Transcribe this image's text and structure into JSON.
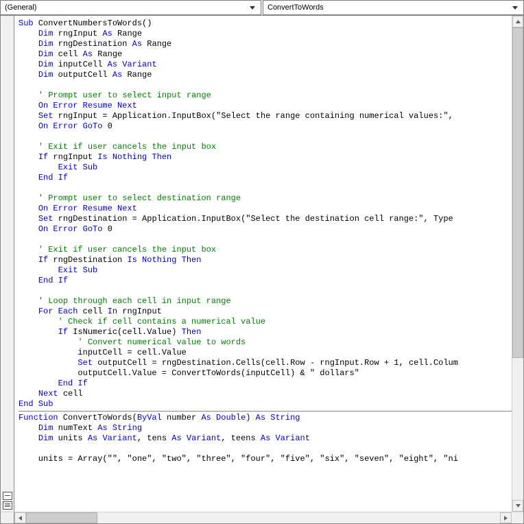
{
  "dropdowns": {
    "left": "(General)",
    "right": "ConvertToWords"
  },
  "code": [
    [
      [
        "kw",
        "Sub"
      ],
      [
        "tx",
        " ConvertNumbersToWords()"
      ]
    ],
    [
      [
        "tx",
        "    "
      ],
      [
        "kw",
        "Dim"
      ],
      [
        "tx",
        " rngInput "
      ],
      [
        "kw",
        "As"
      ],
      [
        "tx",
        " Range"
      ]
    ],
    [
      [
        "tx",
        "    "
      ],
      [
        "kw",
        "Dim"
      ],
      [
        "tx",
        " rngDestination "
      ],
      [
        "kw",
        "As"
      ],
      [
        "tx",
        " Range"
      ]
    ],
    [
      [
        "tx",
        "    "
      ],
      [
        "kw",
        "Dim"
      ],
      [
        "tx",
        " cell "
      ],
      [
        "kw",
        "As"
      ],
      [
        "tx",
        " Range"
      ]
    ],
    [
      [
        "tx",
        "    "
      ],
      [
        "kw",
        "Dim"
      ],
      [
        "tx",
        " inputCell "
      ],
      [
        "kw",
        "As Variant"
      ]
    ],
    [
      [
        "tx",
        "    "
      ],
      [
        "kw",
        "Dim"
      ],
      [
        "tx",
        " outputCell "
      ],
      [
        "kw",
        "As"
      ],
      [
        "tx",
        " Range"
      ]
    ],
    [
      [
        "tx",
        ""
      ]
    ],
    [
      [
        "tx",
        "    "
      ],
      [
        "cm",
        "' Prompt user to select input range"
      ]
    ],
    [
      [
        "tx",
        "    "
      ],
      [
        "kw",
        "On Error Resume Next"
      ]
    ],
    [
      [
        "tx",
        "    "
      ],
      [
        "kw",
        "Set"
      ],
      [
        "tx",
        " rngInput = Application.InputBox(\"Select the range containing numerical values:\", "
      ]
    ],
    [
      [
        "tx",
        "    "
      ],
      [
        "kw",
        "On Error GoTo"
      ],
      [
        "tx",
        " 0"
      ]
    ],
    [
      [
        "tx",
        ""
      ]
    ],
    [
      [
        "tx",
        "    "
      ],
      [
        "cm",
        "' Exit if user cancels the input box"
      ]
    ],
    [
      [
        "tx",
        "    "
      ],
      [
        "kw",
        "If"
      ],
      [
        "tx",
        " rngInput "
      ],
      [
        "kw",
        "Is Nothing Then"
      ]
    ],
    [
      [
        "tx",
        "        "
      ],
      [
        "kw",
        "Exit Sub"
      ]
    ],
    [
      [
        "tx",
        "    "
      ],
      [
        "kw",
        "End If"
      ]
    ],
    [
      [
        "tx",
        ""
      ]
    ],
    [
      [
        "tx",
        "    "
      ],
      [
        "cm",
        "' Prompt user to select destination range"
      ]
    ],
    [
      [
        "tx",
        "    "
      ],
      [
        "kw",
        "On Error Resume Next"
      ]
    ],
    [
      [
        "tx",
        "    "
      ],
      [
        "kw",
        "Set"
      ],
      [
        "tx",
        " rngDestination = Application.InputBox(\"Select the destination cell range:\", Type"
      ]
    ],
    [
      [
        "tx",
        "    "
      ],
      [
        "kw",
        "On Error GoTo"
      ],
      [
        "tx",
        " 0"
      ]
    ],
    [
      [
        "tx",
        ""
      ]
    ],
    [
      [
        "tx",
        "    "
      ],
      [
        "cm",
        "' Exit if user cancels the input box"
      ]
    ],
    [
      [
        "tx",
        "    "
      ],
      [
        "kw",
        "If"
      ],
      [
        "tx",
        " rngDestination "
      ],
      [
        "kw",
        "Is Nothing Then"
      ]
    ],
    [
      [
        "tx",
        "        "
      ],
      [
        "kw",
        "Exit Sub"
      ]
    ],
    [
      [
        "tx",
        "    "
      ],
      [
        "kw",
        "End If"
      ]
    ],
    [
      [
        "tx",
        ""
      ]
    ],
    [
      [
        "tx",
        "    "
      ],
      [
        "cm",
        "' Loop through each cell in input range"
      ]
    ],
    [
      [
        "tx",
        "    "
      ],
      [
        "kw",
        "For Each"
      ],
      [
        "tx",
        " cell "
      ],
      [
        "kw",
        "In"
      ],
      [
        "tx",
        " rngInput"
      ]
    ],
    [
      [
        "tx",
        "        "
      ],
      [
        "cm",
        "' Check if cell contains a numerical value"
      ]
    ],
    [
      [
        "tx",
        "        "
      ],
      [
        "kw",
        "If"
      ],
      [
        "tx",
        " IsNumeric(cell.Value) "
      ],
      [
        "kw",
        "Then"
      ]
    ],
    [
      [
        "tx",
        "            "
      ],
      [
        "cm",
        "' Convert numerical value to words"
      ]
    ],
    [
      [
        "tx",
        "            inputCell = cell.Value"
      ]
    ],
    [
      [
        "tx",
        "            "
      ],
      [
        "kw",
        "Set"
      ],
      [
        "tx",
        " outputCell = rngDestination.Cells(cell.Row - rngInput.Row + 1, cell.Colum"
      ]
    ],
    [
      [
        "tx",
        "            outputCell.Value = ConvertToWords(inputCell) & \" dollars\""
      ]
    ],
    [
      [
        "tx",
        "        "
      ],
      [
        "kw",
        "End If"
      ]
    ],
    [
      [
        "tx",
        "    "
      ],
      [
        "kw",
        "Next"
      ],
      [
        "tx",
        " cell"
      ]
    ],
    [
      [
        "kw",
        "End Sub"
      ]
    ]
  ],
  "code2": [
    [
      [
        "kw",
        "Function"
      ],
      [
        "tx",
        " ConvertToWords("
      ],
      [
        "kw",
        "ByVal"
      ],
      [
        "tx",
        " number "
      ],
      [
        "kw",
        "As Double"
      ],
      [
        "tx",
        ") "
      ],
      [
        "kw",
        "As String"
      ]
    ],
    [
      [
        "tx",
        "    "
      ],
      [
        "kw",
        "Dim"
      ],
      [
        "tx",
        " numText "
      ],
      [
        "kw",
        "As String"
      ]
    ],
    [
      [
        "tx",
        "    "
      ],
      [
        "kw",
        "Dim"
      ],
      [
        "tx",
        " units "
      ],
      [
        "kw",
        "As Variant"
      ],
      [
        "tx",
        ", tens "
      ],
      [
        "kw",
        "As Variant"
      ],
      [
        "tx",
        ", teens "
      ],
      [
        "kw",
        "As Variant"
      ]
    ],
    [
      [
        "tx",
        ""
      ]
    ],
    [
      [
        "tx",
        "    units = Array(\"\", \"one\", \"two\", \"three\", \"four\", \"five\", \"six\", \"seven\", \"eight\", \"ni"
      ]
    ]
  ]
}
